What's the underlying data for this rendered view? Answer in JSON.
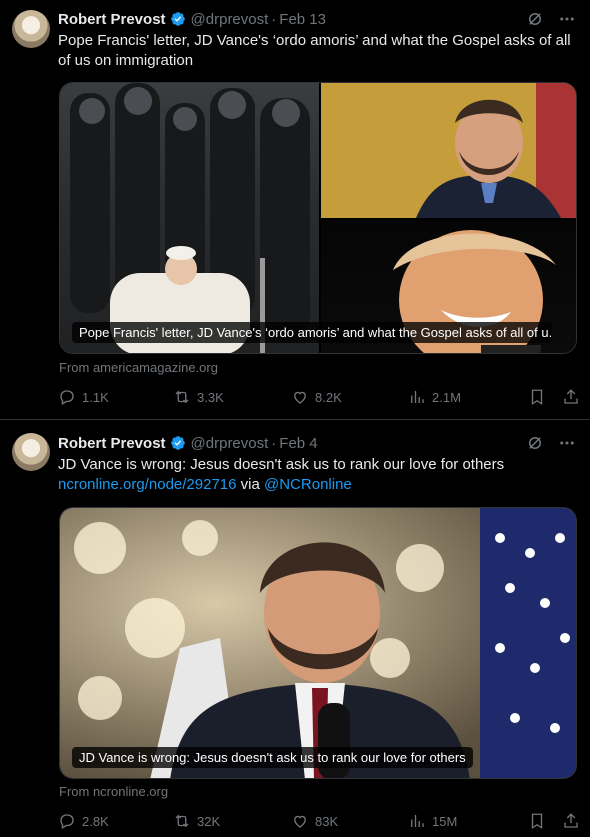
{
  "tweets": [
    {
      "author": "Robert Prevost",
      "handle": "@drprevost",
      "separator": "·",
      "date": "Feb 13",
      "text": "Pope Francis' letter, JD Vance's ‘ordo amoris’ and what the Gospel asks of all of us on immigration",
      "media_caption": "Pope Francis' letter, JD Vance's ‘ordo amoris’ and what the Gospel asks of all of u...",
      "source": "From americamagazine.org",
      "replies": "1.1K",
      "reposts": "3.3K",
      "likes": "8.2K",
      "views": "2.1M"
    },
    {
      "author": "Robert Prevost",
      "handle": "@drprevost",
      "separator": "·",
      "date": "Feb 4",
      "text": "JD Vance is wrong: Jesus doesn't ask us to rank our love for others",
      "link_url": "ncronline.org/node/292716",
      "via_text": " via ",
      "mention": "@NCRonline",
      "media_caption": "JD Vance is wrong: Jesus doesn't ask us to rank our love for others",
      "source": "From ncronline.org",
      "replies": "2.8K",
      "reposts": "32K",
      "likes": "83K",
      "views": "15M"
    }
  ],
  "colors": {
    "background": "#000000",
    "text": "#e7e9ea",
    "muted": "#71767b",
    "link": "#1d9bf0",
    "divider": "#2f3336"
  },
  "icons": [
    "verified-badge-icon",
    "grok-icon",
    "more-icon",
    "reply-icon",
    "repost-icon",
    "like-icon",
    "views-icon",
    "bookmark-icon",
    "share-icon"
  ]
}
